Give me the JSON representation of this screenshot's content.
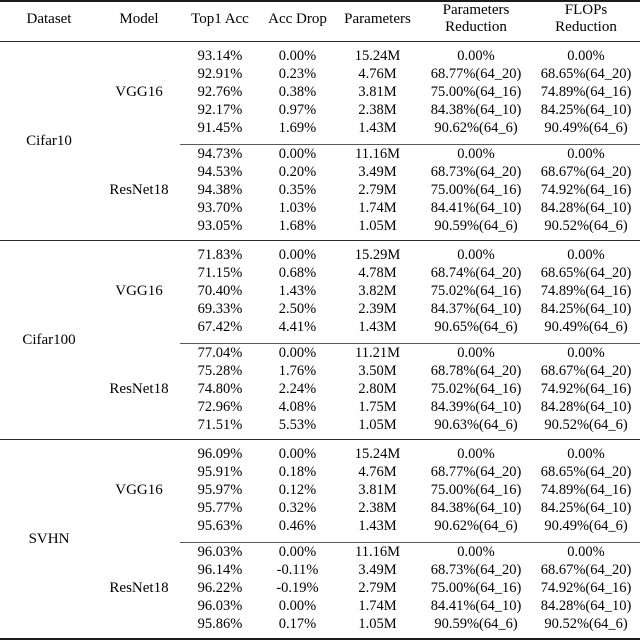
{
  "table": {
    "caption": "",
    "columns": [
      {
        "key": "dataset",
        "label": "Dataset"
      },
      {
        "key": "model",
        "label": "Model"
      },
      {
        "key": "top1",
        "label": "Top1 Acc"
      },
      {
        "key": "acc_drop",
        "label": "Acc Drop"
      },
      {
        "key": "parameters",
        "label": "Parameters"
      },
      {
        "key": "params_red",
        "label_line1": "Parameters",
        "label_line2": "Reduction"
      },
      {
        "key": "flops_red",
        "label_line1": "FLOPs",
        "label_line2": "Reduction"
      }
    ],
    "groups": [
      {
        "dataset": "Cifar10",
        "models": [
          {
            "model": "VGG16",
            "rows": [
              {
                "top1": "93.14%",
                "acc_drop": "0.00%",
                "parameters": "15.24M",
                "params_red": "0.00%",
                "flops_red": "0.00%"
              },
              {
                "top1": "92.91%",
                "acc_drop": "0.23%",
                "parameters": "4.76M",
                "params_red": "68.77%(64_20)",
                "flops_red": "68.65%(64_20)"
              },
              {
                "top1": "92.76%",
                "acc_drop": "0.38%",
                "parameters": "3.81M",
                "params_red": "75.00%(64_16)",
                "flops_red": "74.89%(64_16)"
              },
              {
                "top1": "92.17%",
                "acc_drop": "0.97%",
                "parameters": "2.38M",
                "params_red": "84.38%(64_10)",
                "flops_red": "84.25%(64_10)"
              },
              {
                "top1": "91.45%",
                "acc_drop": "1.69%",
                "parameters": "1.43M",
                "params_red": "90.62%(64_6)",
                "flops_red": "90.49%(64_6)"
              }
            ]
          },
          {
            "model": "ResNet18",
            "rows": [
              {
                "top1": "94.73%",
                "acc_drop": "0.00%",
                "parameters": "11.16M",
                "params_red": "0.00%",
                "flops_red": "0.00%"
              },
              {
                "top1": "94.53%",
                "acc_drop": "0.20%",
                "parameters": "3.49M",
                "params_red": "68.73%(64_20)",
                "flops_red": "68.67%(64_20)"
              },
              {
                "top1": "94.38%",
                "acc_drop": "0.35%",
                "parameters": "2.79M",
                "params_red": "75.00%(64_16)",
                "flops_red": "74.92%(64_16)"
              },
              {
                "top1": "93.70%",
                "acc_drop": "1.03%",
                "parameters": "1.74M",
                "params_red": "84.41%(64_10)",
                "flops_red": "84.28%(64_10)"
              },
              {
                "top1": "93.05%",
                "acc_drop": "1.68%",
                "parameters": "1.05M",
                "params_red": "90.59%(64_6)",
                "flops_red": "90.52%(64_6)"
              }
            ]
          }
        ]
      },
      {
        "dataset": "Cifar100",
        "models": [
          {
            "model": "VGG16",
            "rows": [
              {
                "top1": "71.83%",
                "acc_drop": "0.00%",
                "parameters": "15.29M",
                "params_red": "0.00%",
                "flops_red": "0.00%"
              },
              {
                "top1": "71.15%",
                "acc_drop": "0.68%",
                "parameters": "4.78M",
                "params_red": "68.74%(64_20)",
                "flops_red": "68.65%(64_20)"
              },
              {
                "top1": "70.40%",
                "acc_drop": "1.43%",
                "parameters": "3.82M",
                "params_red": "75.02%(64_16)",
                "flops_red": "74.89%(64_16)"
              },
              {
                "top1": "69.33%",
                "acc_drop": "2.50%",
                "parameters": "2.39M",
                "params_red": "84.37%(64_10)",
                "flops_red": "84.25%(64_10)"
              },
              {
                "top1": "67.42%",
                "acc_drop": "4.41%",
                "parameters": "1.43M",
                "params_red": "90.65%(64_6)",
                "flops_red": "90.49%(64_6)"
              }
            ]
          },
          {
            "model": "ResNet18",
            "rows": [
              {
                "top1": "77.04%",
                "acc_drop": "0.00%",
                "parameters": "11.21M",
                "params_red": "0.00%",
                "flops_red": "0.00%"
              },
              {
                "top1": "75.28%",
                "acc_drop": "1.76%",
                "parameters": "3.50M",
                "params_red": "68.78%(64_20)",
                "flops_red": "68.67%(64_20)"
              },
              {
                "top1": "74.80%",
                "acc_drop": "2.24%",
                "parameters": "2.80M",
                "params_red": "75.02%(64_16)",
                "flops_red": "74.92%(64_16)"
              },
              {
                "top1": "72.96%",
                "acc_drop": "4.08%",
                "parameters": "1.75M",
                "params_red": "84.39%(64_10)",
                "flops_red": "84.28%(64_10)"
              },
              {
                "top1": "71.51%",
                "acc_drop": "5.53%",
                "parameters": "1.05M",
                "params_red": "90.63%(64_6)",
                "flops_red": "90.52%(64_6)"
              }
            ]
          }
        ]
      },
      {
        "dataset": "SVHN",
        "models": [
          {
            "model": "VGG16",
            "rows": [
              {
                "top1": "96.09%",
                "acc_drop": "0.00%",
                "parameters": "15.24M",
                "params_red": "0.00%",
                "flops_red": "0.00%"
              },
              {
                "top1": "95.91%",
                "acc_drop": "0.18%",
                "parameters": "4.76M",
                "params_red": "68.77%(64_20)",
                "flops_red": "68.65%(64_20)"
              },
              {
                "top1": "95.97%",
                "acc_drop": "0.12%",
                "parameters": "3.81M",
                "params_red": "75.00%(64_16)",
                "flops_red": "74.89%(64_16)"
              },
              {
                "top1": "95.77%",
                "acc_drop": "0.32%",
                "parameters": "2.38M",
                "params_red": "84.38%(64_10)",
                "flops_red": "84.25%(64_10)"
              },
              {
                "top1": "95.63%",
                "acc_drop": "0.46%",
                "parameters": "1.43M",
                "params_red": "90.62%(64_6)",
                "flops_red": "90.49%(64_6)"
              }
            ]
          },
          {
            "model": "ResNet18",
            "rows": [
              {
                "top1": "96.03%",
                "acc_drop": "0.00%",
                "parameters": "11.16M",
                "params_red": "0.00%",
                "flops_red": "0.00%"
              },
              {
                "top1": "96.14%",
                "acc_drop": "-0.11%",
                "parameters": "3.49M",
                "params_red": "68.73%(64_20)",
                "flops_red": "68.67%(64_20)"
              },
              {
                "top1": "96.22%",
                "acc_drop": "-0.19%",
                "parameters": "2.79M",
                "params_red": "75.00%(64_16)",
                "flops_red": "74.92%(64_16)"
              },
              {
                "top1": "96.03%",
                "acc_drop": "0.00%",
                "parameters": "1.74M",
                "params_red": "84.41%(64_10)",
                "flops_red": "84.28%(64_10)"
              },
              {
                "top1": "95.86%",
                "acc_drop": "0.17%",
                "parameters": "1.05M",
                "params_red": "90.59%(64_6)",
                "flops_red": "90.52%(64_6)"
              }
            ]
          }
        ]
      }
    ]
  }
}
